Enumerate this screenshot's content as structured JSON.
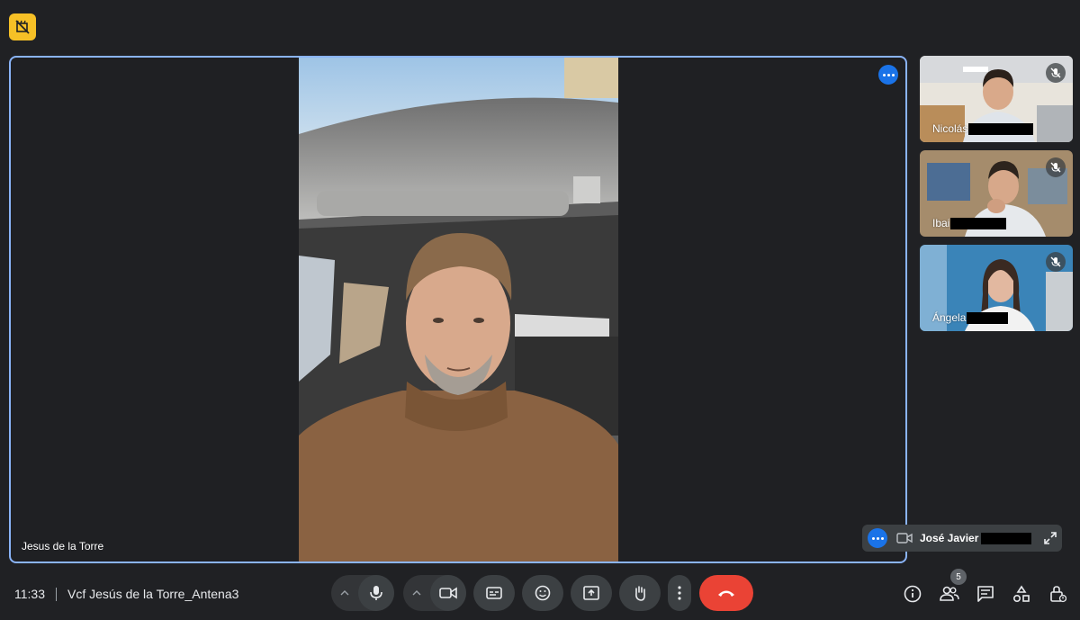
{
  "main_speaker": {
    "name": "Jesus de la Torre"
  },
  "participants": [
    {
      "name": "Nicolás",
      "muted": true
    },
    {
      "name": "Ibai",
      "muted": true
    },
    {
      "name": "Ángela",
      "muted": true
    }
  ],
  "self_view": {
    "name": "José Javier"
  },
  "meeting": {
    "time": "11:33",
    "title": "Vcf Jesús de la Torre_Antena3"
  },
  "people_count": "5",
  "icons": {
    "recording_off": "no-recording-icon",
    "more": "more-options-icon",
    "mic": "microphone-icon",
    "camera": "camera-icon",
    "captions": "closed-captions-icon",
    "reactions": "emoji-icon",
    "present": "present-screen-icon",
    "raise_hand": "raise-hand-icon",
    "end_call": "end-call-icon",
    "info": "info-icon",
    "people": "people-icon",
    "chat": "chat-icon",
    "activities": "activities-icon",
    "host_controls": "host-controls-icon"
  },
  "colors": {
    "accent": "#8ab4f8",
    "end_call": "#ea4335",
    "recording_badge": "#f6c026",
    "background": "#202124"
  }
}
